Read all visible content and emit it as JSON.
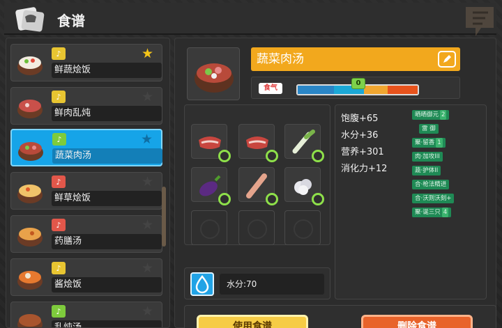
{
  "header": {
    "title": "食谱"
  },
  "recipes": [
    {
      "name": "鲜蔬烩饭",
      "tag": "yellow",
      "starred": true,
      "selected": false
    },
    {
      "name": "鲜肉乱炖",
      "tag": "yellow",
      "starred": false,
      "selected": false
    },
    {
      "name": "蔬菜肉汤",
      "tag": "green",
      "starred": false,
      "selected": true
    },
    {
      "name": "鲜草烩饭",
      "tag": "red",
      "starred": false,
      "selected": false
    },
    {
      "name": "药膳汤",
      "tag": "red",
      "starred": false,
      "selected": false
    },
    {
      "name": "酱烩饭",
      "tag": "yellow",
      "starred": false,
      "selected": false
    },
    {
      "name": "乱炖汤",
      "tag": "green",
      "starred": false,
      "selected": false
    }
  ],
  "detail": {
    "dish_name": "蔬菜肉汤",
    "aroma_label": "食气",
    "aroma_value": "0",
    "stats": [
      "饱腹+65",
      "水分+36",
      "营养+301",
      "消化力+12"
    ],
    "effects": [
      {
        "label": "晒晒御元",
        "num": "2"
      },
      {
        "label": "雷 御",
        "num": ""
      },
      {
        "label": "聚·留香",
        "num": "1"
      },
      {
        "label": "肉·加攻III",
        "num": ""
      },
      {
        "label": "蔬·护体II",
        "num": ""
      },
      {
        "label": "合·枪法精进",
        "num": ""
      },
      {
        "label": "合·沃则沃刻+",
        "num": ""
      },
      {
        "label": "聚·诞三只",
        "num": "4"
      }
    ],
    "water_text": "水分:70"
  },
  "buttons": {
    "use": "使用食谱",
    "delete": "删除食谱"
  },
  "colors": {
    "accent_orange": "#f2a81d",
    "selected_blue": "#16a4e8",
    "effect_green": "#1f8a55"
  }
}
